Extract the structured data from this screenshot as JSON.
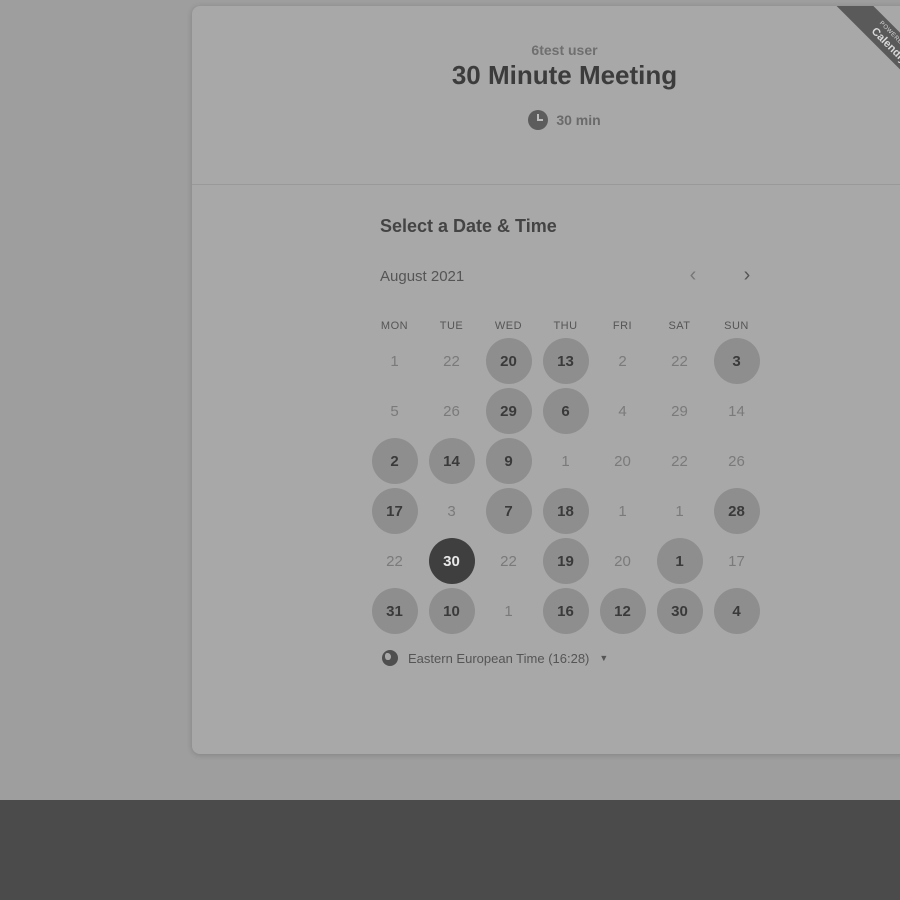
{
  "event": {
    "owner": "6test user",
    "title": "30 Minute Meeting",
    "duration": "30 min"
  },
  "badge": {
    "line1": "POWERED BY",
    "line2": "Calendly"
  },
  "picker": {
    "title": "Select a Date & Time",
    "month": "August 2021",
    "prev_icon": "chevron-left-icon",
    "next_icon": "chevron-right-icon",
    "weekdays": [
      "MON",
      "TUE",
      "WED",
      "THU",
      "FRI",
      "SAT",
      "SUN"
    ],
    "days": [
      [
        "1",
        "22",
        "20",
        "13",
        "2",
        "22",
        "3"
      ],
      [
        "5",
        "26",
        "29",
        "6",
        "4",
        "29",
        "14"
      ],
      [
        "2",
        "14",
        "9",
        "1",
        "20",
        "22",
        "26"
      ],
      [
        "17",
        "3",
        "7",
        "18",
        "1",
        "1",
        "28"
      ],
      [
        "22",
        "30",
        "22",
        "19",
        "20",
        "1",
        "17"
      ],
      [
        "31",
        "10",
        "1",
        "16",
        "12",
        "30",
        "4"
      ]
    ],
    "day_states": [
      [
        "none",
        "none",
        "avail",
        "avail",
        "none",
        "none",
        "avail"
      ],
      [
        "none",
        "none",
        "avail",
        "avail",
        "none",
        "none",
        "none"
      ],
      [
        "avail",
        "avail",
        "avail",
        "none",
        "none",
        "none",
        "none"
      ],
      [
        "avail",
        "none",
        "avail",
        "avail",
        "none",
        "none",
        "avail"
      ],
      [
        "none",
        "selected",
        "none",
        "avail",
        "none",
        "avail",
        "none"
      ],
      [
        "avail",
        "avail",
        "none",
        "avail",
        "avail",
        "avail",
        "avail"
      ]
    ],
    "timezone": "Eastern European Time (16:28)",
    "timezone_icon": "globe-icon"
  },
  "colors": {
    "available_bg": "#8e8e8e",
    "selected_bg": "#3f3f3f",
    "card_bg": "#a8a8a8"
  }
}
